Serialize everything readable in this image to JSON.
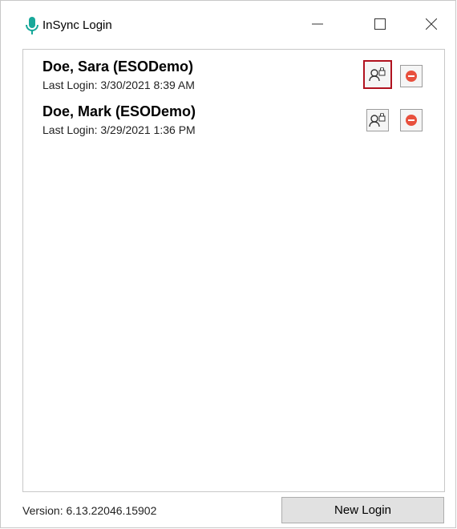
{
  "window": {
    "title": "InSync Login",
    "accent_color": "#18a89a"
  },
  "logins": [
    {
      "name": "Doe, Sara (ESODemo)",
      "last_login": "Last Login: 3/30/2021 8:39 AM",
      "switch_icon": "user-lock-icon",
      "remove_icon": "remove-icon",
      "focused": true
    },
    {
      "name": "Doe, Mark (ESODemo)",
      "last_login": "Last Login: 3/29/2021 1:36 PM",
      "switch_icon": "user-lock-icon",
      "remove_icon": "remove-icon",
      "focused": false
    }
  ],
  "footer": {
    "version": "Version: 6.13.22046.15902",
    "new_login_label": "New Login"
  },
  "colors": {
    "focus_border": "#b1121f",
    "remove_red": "#e8503d"
  }
}
